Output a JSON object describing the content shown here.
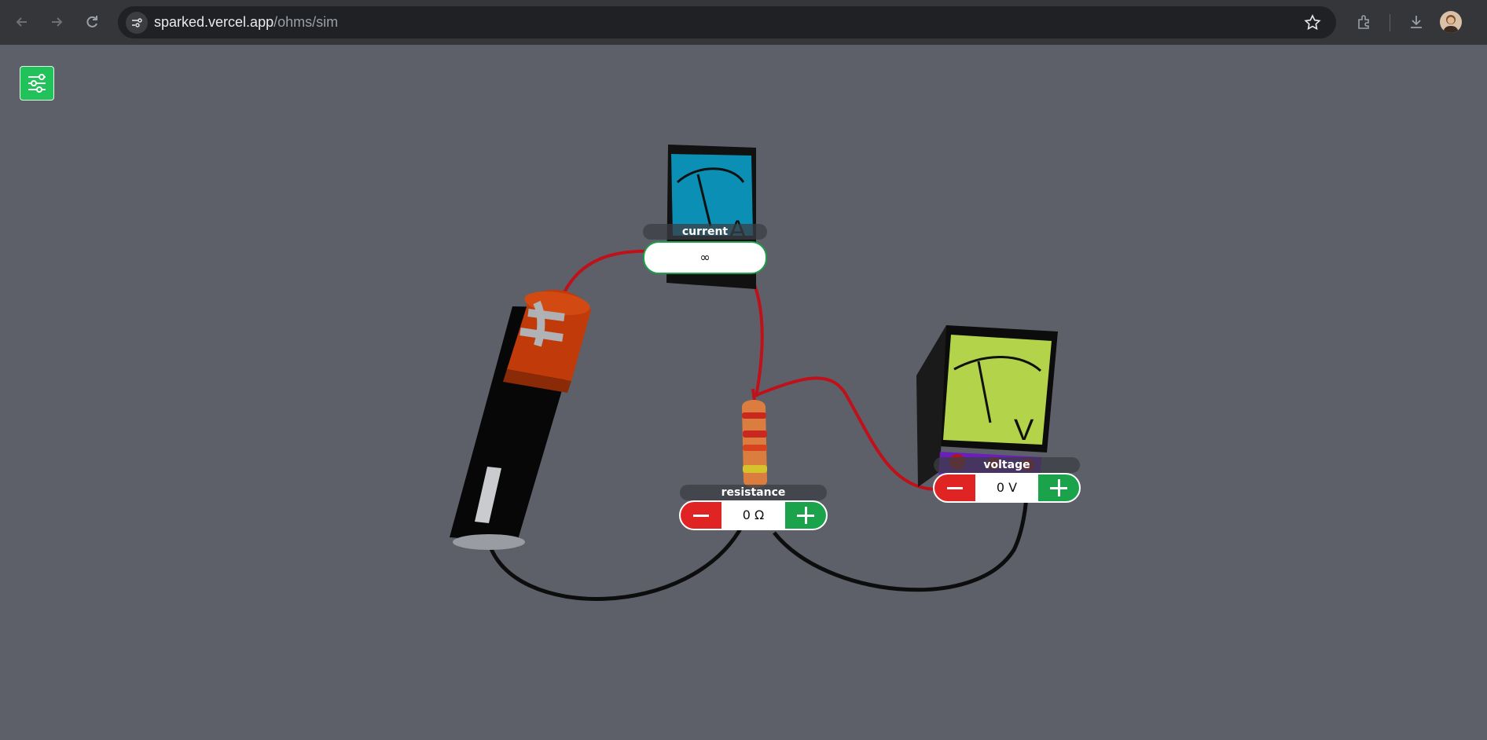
{
  "browser": {
    "url_domain": "sparked.vercel.app",
    "url_path": "/ohms/sim"
  },
  "current": {
    "label": "current",
    "value": "∞",
    "unit_glyph": "A"
  },
  "resistance": {
    "label": "resistance",
    "value": "0 Ω"
  },
  "voltage": {
    "label": "voltage",
    "value": "0 V",
    "unit_glyph": "V"
  },
  "colors": {
    "background": "#5d6068",
    "accent_green": "#1aa34a",
    "decrement_red": "#e02424",
    "wire_red": "#c0101a",
    "wire_black": "#111111",
    "ammeter_face": "#0b8fb5",
    "voltmeter_face": "#b3d44a"
  },
  "icons": [
    "back-icon",
    "forward-icon",
    "reload-icon",
    "site-info-icon",
    "bookmark-star-icon",
    "extensions-icon",
    "download-icon",
    "settings-sliders-icon"
  ]
}
